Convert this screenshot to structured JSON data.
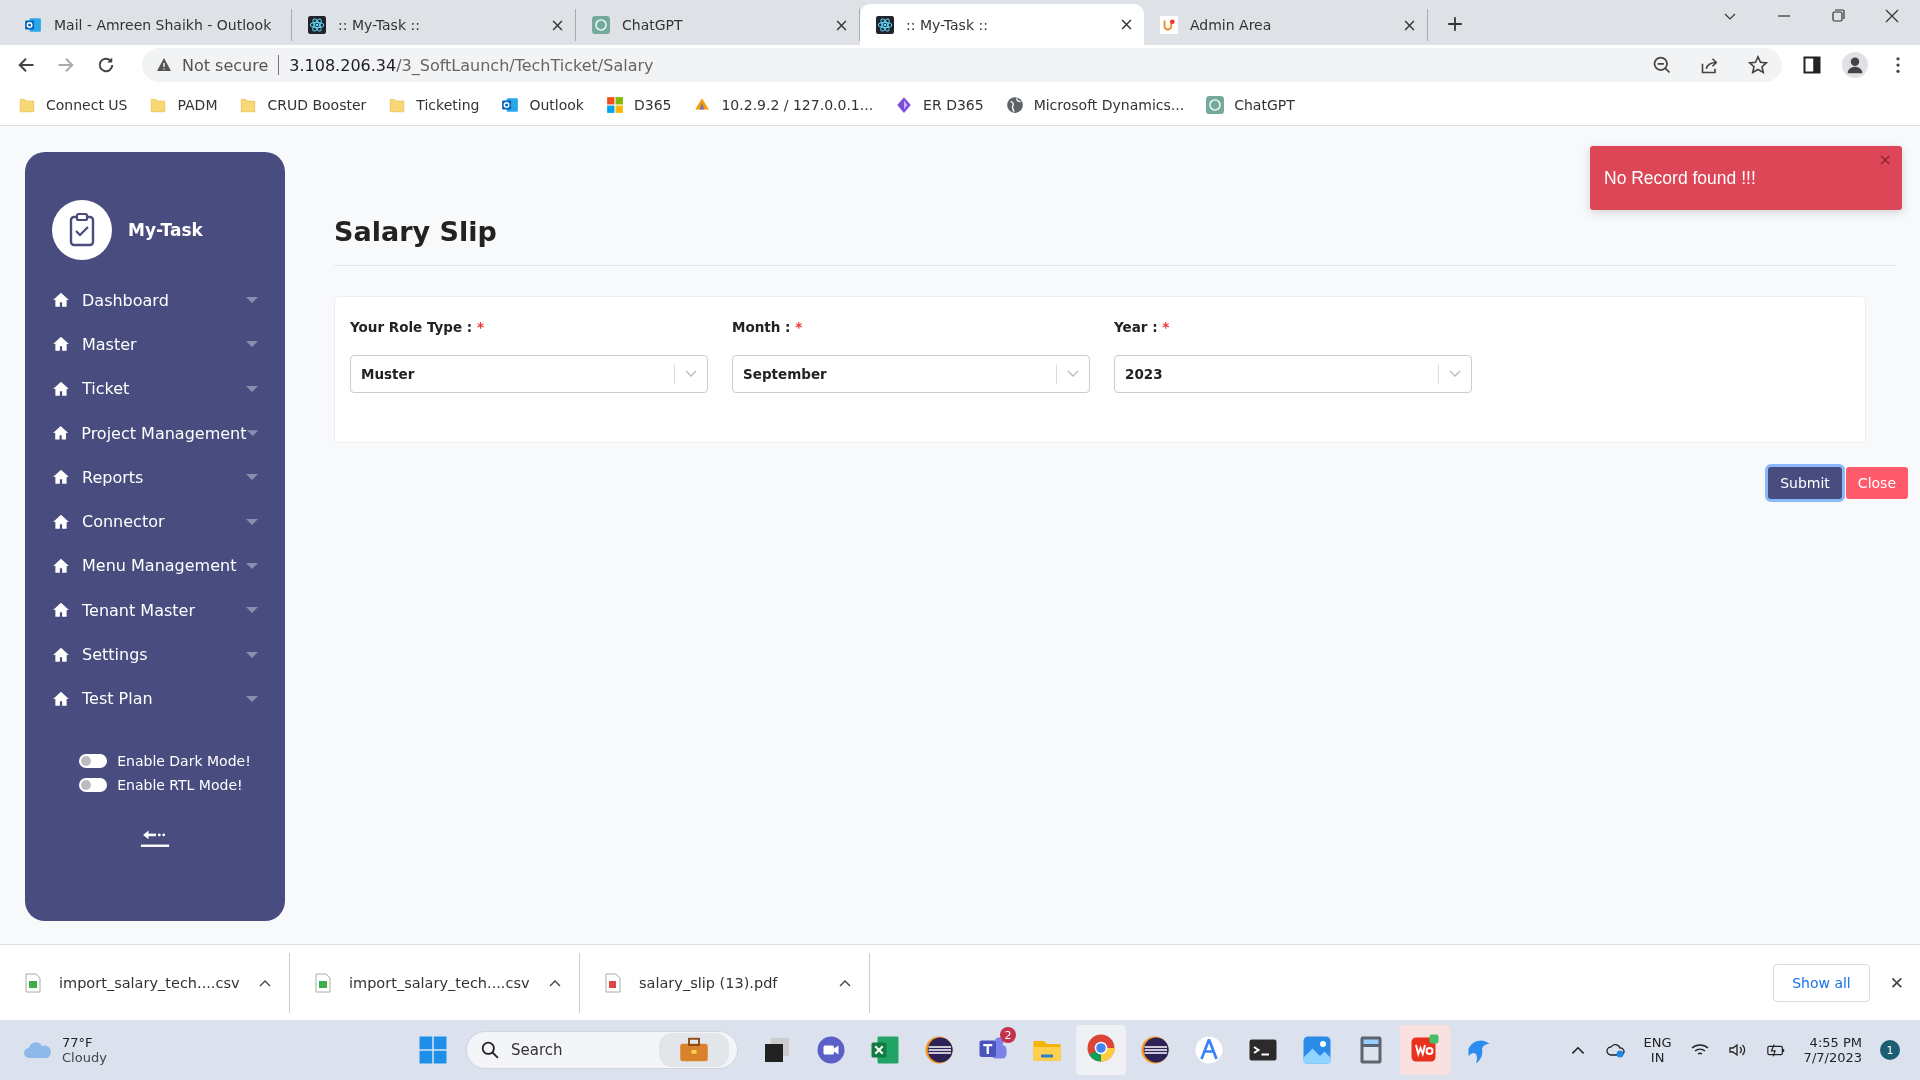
{
  "browser": {
    "tabs": [
      {
        "title": "Mail - Amreen Shaikh - Outlook",
        "kind": "outlook",
        "selected": false
      },
      {
        "title": ":: My-Task ::",
        "kind": "react",
        "selected": false
      },
      {
        "title": "ChatGPT",
        "kind": "gpt",
        "selected": false
      },
      {
        "title": ":: My-Task ::",
        "kind": "react",
        "selected": true
      },
      {
        "title": "Admin Area",
        "kind": "admin",
        "selected": false
      }
    ],
    "address": {
      "warning": "Not secure",
      "host": "3.108.206.34",
      "path": "/3_SoftLaunch/TechTicket/Salary"
    },
    "bookmarks": [
      {
        "label": "Connect US",
        "kind": "folder"
      },
      {
        "label": "PADM",
        "kind": "folder"
      },
      {
        "label": "CRUD Booster",
        "kind": "folder"
      },
      {
        "label": "Ticketing",
        "kind": "folder"
      },
      {
        "label": "Outlook",
        "kind": "outlook"
      },
      {
        "label": "D365",
        "kind": "ms"
      },
      {
        "label": "10.2.9.2 / 127.0.0.1...",
        "kind": "pma"
      },
      {
        "label": "ER D365",
        "kind": "diamond"
      },
      {
        "label": "Microsoft Dynamics...",
        "kind": "globe"
      },
      {
        "label": "ChatGPT",
        "kind": "gpt"
      }
    ]
  },
  "sidebar": {
    "brand": "My-Task",
    "items": [
      {
        "label": "Dashboard"
      },
      {
        "label": "Master"
      },
      {
        "label": "Ticket"
      },
      {
        "label": "Project Management"
      },
      {
        "label": "Reports"
      },
      {
        "label": "Connector"
      },
      {
        "label": "Menu Management"
      },
      {
        "label": "Tenant Master"
      },
      {
        "label": "Settings"
      },
      {
        "label": "Test Plan"
      }
    ],
    "toggles": [
      {
        "label": "Enable Dark Mode!",
        "on": false
      },
      {
        "label": "Enable RTL Mode!",
        "on": false
      }
    ]
  },
  "page": {
    "title": "Salary Slip",
    "fields": [
      {
        "label": "Your Role Type :",
        "required": "*",
        "value": "Muster"
      },
      {
        "label": "Month :",
        "required": "*",
        "value": "September"
      },
      {
        "label": "Year :",
        "required": "*",
        "value": "2023"
      }
    ],
    "buttons": [
      {
        "label": "Submit",
        "kind": "primary"
      },
      {
        "label": "Close",
        "kind": "danger"
      }
    ]
  },
  "toast": {
    "message": "No Record found !!!",
    "close": "×"
  },
  "downloads": {
    "items": [
      {
        "name": "import_salary_tech....csv",
        "kind": "csv"
      },
      {
        "name": "import_salary_tech....csv",
        "kind": "csv"
      },
      {
        "name": "salary_slip (13).pdf",
        "kind": "pdf"
      }
    ],
    "show_all": "Show all",
    "close": "✕"
  },
  "taskbar": {
    "weather": {
      "temp": "77°F",
      "condition": "Cloudy"
    },
    "search": "Search",
    "teams_badge": "2",
    "lang": "ENG",
    "region": "IN",
    "time": "4:55 PM",
    "date": "7/7/2023",
    "notifications": "1"
  }
}
